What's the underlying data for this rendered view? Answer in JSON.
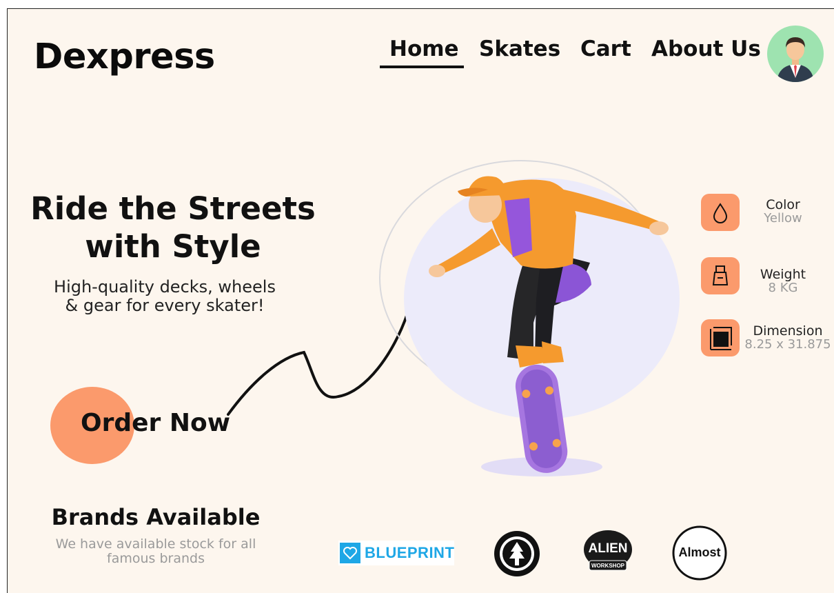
{
  "brand": {
    "name": "Dexpress"
  },
  "nav": {
    "items": [
      {
        "label": "Home",
        "active": true
      },
      {
        "label": "Skates"
      },
      {
        "label": "Cart"
      },
      {
        "label": "About Us"
      }
    ]
  },
  "hero": {
    "title_line1": "Ride the Streets",
    "title_line2": "with Style",
    "subtitle_line1": "High-quality decks, wheels",
    "subtitle_line2": "& gear for every skater!",
    "cta_label": "Order Now"
  },
  "specs": [
    {
      "icon": "drop-icon",
      "label": "Color",
      "value": "Yellow"
    },
    {
      "icon": "weight-icon",
      "label": "Weight",
      "value": "8 KG"
    },
    {
      "icon": "dimension-icon",
      "label": "Dimension",
      "value": "8.25 x 31.875"
    }
  ],
  "brands": {
    "title": "Brands Available",
    "subtitle_line1": "We have available stock for all",
    "subtitle_line2": "famous brands",
    "logos": [
      {
        "name": "BLUEPRINT"
      },
      {
        "name": "element-logo"
      },
      {
        "name": "alien-workshop-logo",
        "text": "ALIEN",
        "subtext": "WORKSHOP"
      },
      {
        "name": "almost-logo",
        "text": "Almost"
      }
    ]
  },
  "colors": {
    "background": "#fdf6ee",
    "accent": "#fb9a6c",
    "avatar_bg": "#9ee3b0",
    "blueprint_blue": "#1ea7e6",
    "muted_text": "#9a9a9a"
  }
}
